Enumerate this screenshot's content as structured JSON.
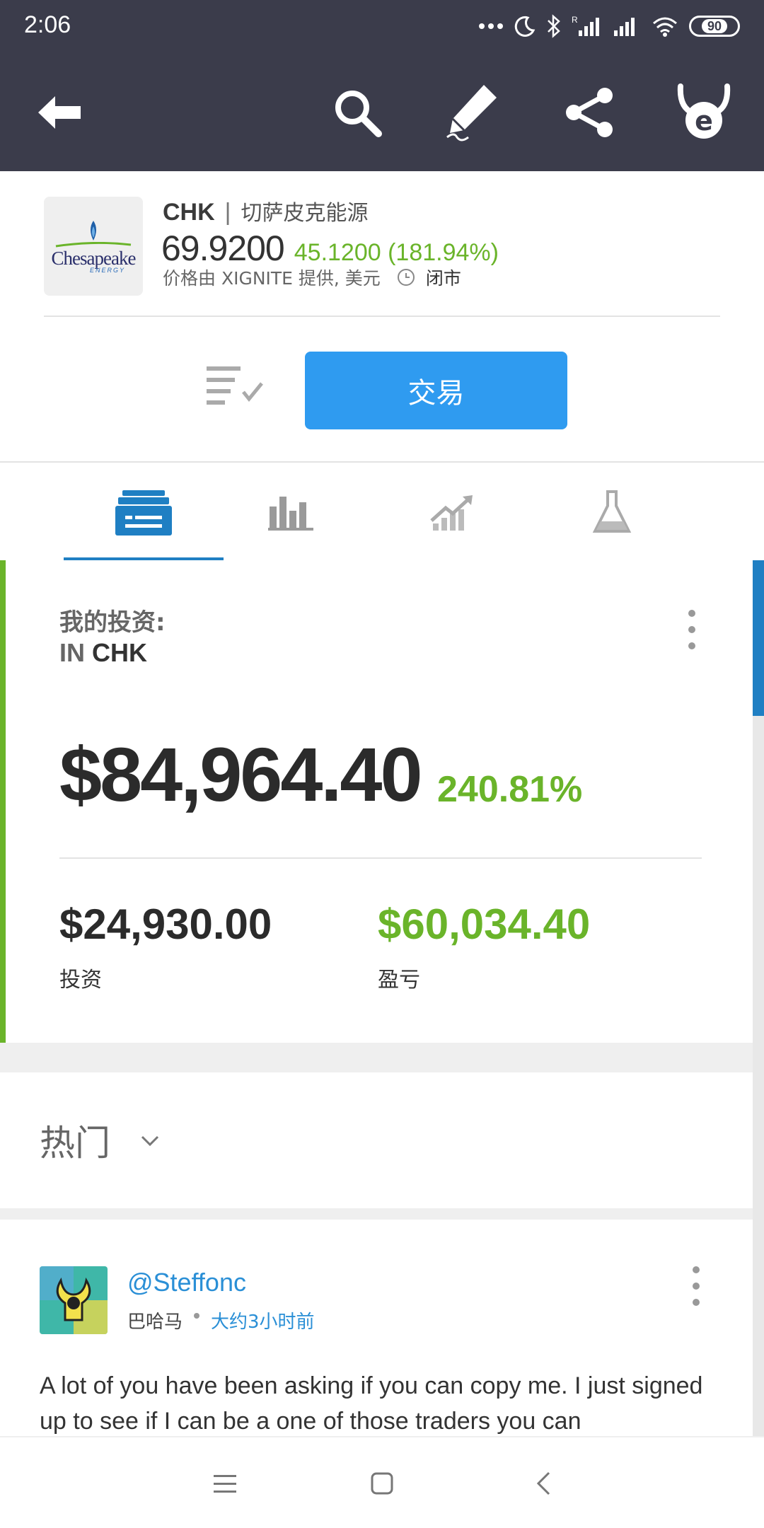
{
  "status_bar": {
    "time": "2:06",
    "battery": "90",
    "icons": [
      "more-dots-icon",
      "moon-icon",
      "bluetooth-icon",
      "signal-r-icon",
      "signal-icon",
      "wifi-icon",
      "battery-icon"
    ]
  },
  "app_bar": {
    "icons": [
      "back-arrow-icon",
      "search-icon",
      "edit-pencil-icon",
      "share-icon",
      "etoro-logo-icon"
    ]
  },
  "instrument": {
    "logo_text": "Chesapeake",
    "logo_sub": "ENERGY",
    "ticker": "CHK",
    "separator": "|",
    "name_cn": "切萨皮克能源",
    "price": "69.9200",
    "change": "45.1200 (181.94%)",
    "source": "价格由 XIGNITE 提供, 美元",
    "market_status": "闭市"
  },
  "actions": {
    "trade_label": "交易"
  },
  "tabs": [
    {
      "name": "portfolio",
      "icon": "portfolio-card-icon",
      "active": true
    },
    {
      "name": "stats",
      "icon": "bar-chart-icon",
      "active": false
    },
    {
      "name": "chart",
      "icon": "trend-chart-icon",
      "active": false
    },
    {
      "name": "research",
      "icon": "flask-icon",
      "active": false
    }
  ],
  "investment": {
    "title": "我的投资:",
    "in_prefix": "IN",
    "in_ticker": "CHK",
    "total_value": "$84,964.40",
    "total_pct": "240.81%",
    "invested_value": "$24,930.00",
    "invested_label": "投资",
    "pl_value": "$60,034.40",
    "pl_label": "盈亏"
  },
  "feed": {
    "filter_label": "热门",
    "post": {
      "username": "@Steffonc",
      "location": "巴哈马",
      "timestamp": "大约3小时前",
      "text": "A lot of you have been asking if you can copy me. I just signed up to see if I can be a one of those traders you can"
    }
  },
  "colors": {
    "header_bg": "#3b3c4b",
    "accent_blue": "#2f9bf0",
    "tab_active": "#1f7fc3",
    "gain_green": "#6ab42a"
  }
}
